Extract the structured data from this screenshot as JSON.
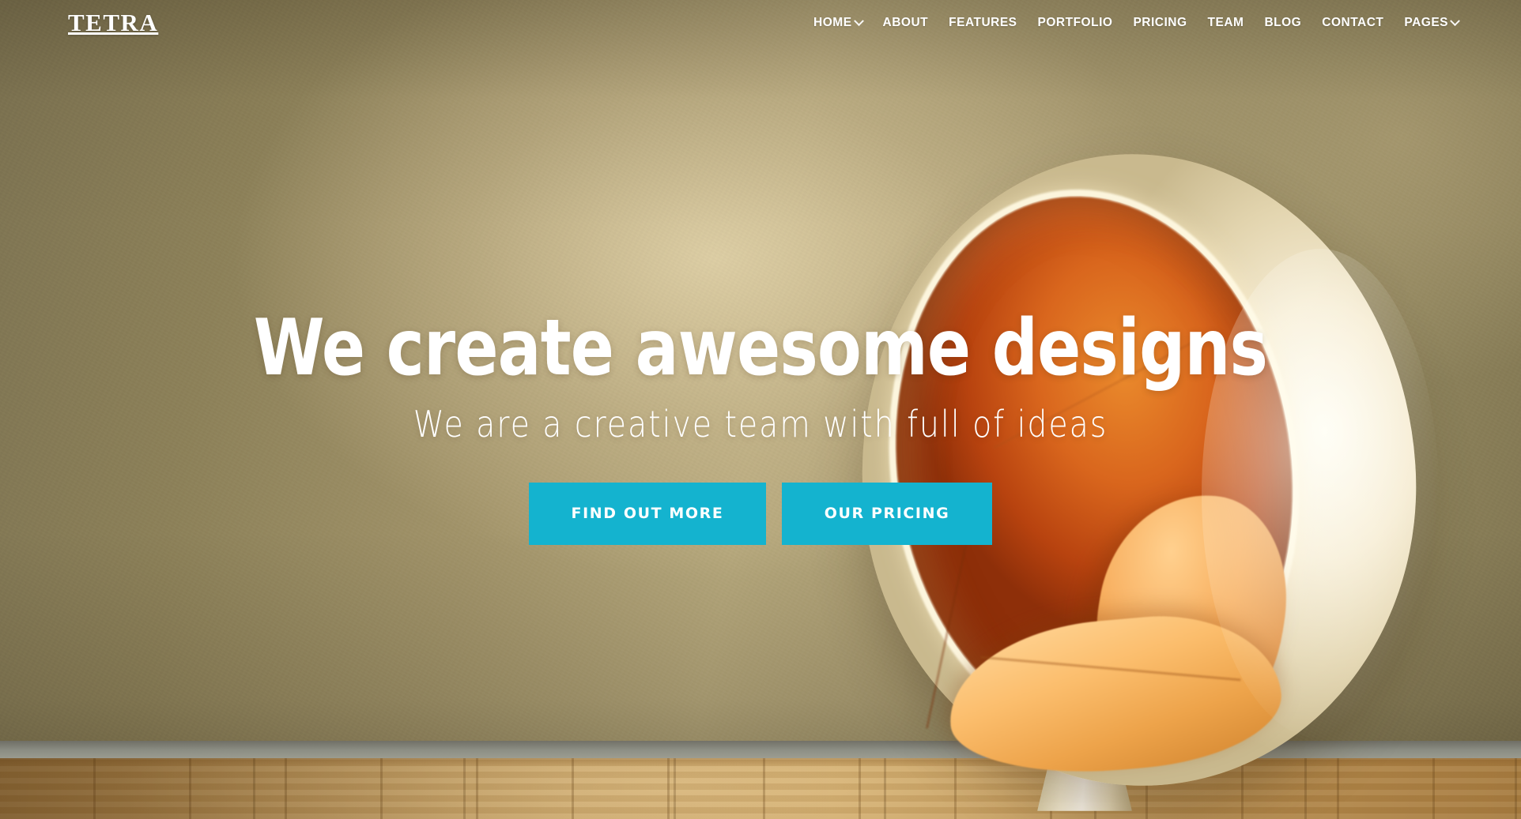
{
  "site": {
    "brand": "TETRA"
  },
  "nav": {
    "items": [
      {
        "label": "HOME",
        "has_dropdown": true
      },
      {
        "label": "ABOUT",
        "has_dropdown": false
      },
      {
        "label": "FEATURES",
        "has_dropdown": false
      },
      {
        "label": "PORTFOLIO",
        "has_dropdown": false
      },
      {
        "label": "PRICING",
        "has_dropdown": false
      },
      {
        "label": "TEAM",
        "has_dropdown": false
      },
      {
        "label": "BLOG",
        "has_dropdown": false
      },
      {
        "label": "CONTACT",
        "has_dropdown": false
      },
      {
        "label": "PAGES",
        "has_dropdown": true
      }
    ]
  },
  "hero": {
    "title": "We create awesome designs",
    "subtitle": "We are a creative team with full of ideas",
    "primary_button": "FIND OUT MORE",
    "secondary_button": "OUR PRICING",
    "background_description": "Interior photo of a cream ball chair with orange upholstery against an olive wall on a wooden floor"
  },
  "colors": {
    "accent": "#14b3cf",
    "text_on_hero": "#ffffff",
    "wall_light": "#c6b68d",
    "wall_dark": "#7e7452",
    "chair_shell": "#fdf6e2",
    "chair_interior": "#d9661d",
    "floor": "#c9a262"
  },
  "icons": {
    "dropdown": "chevron-down-icon"
  }
}
